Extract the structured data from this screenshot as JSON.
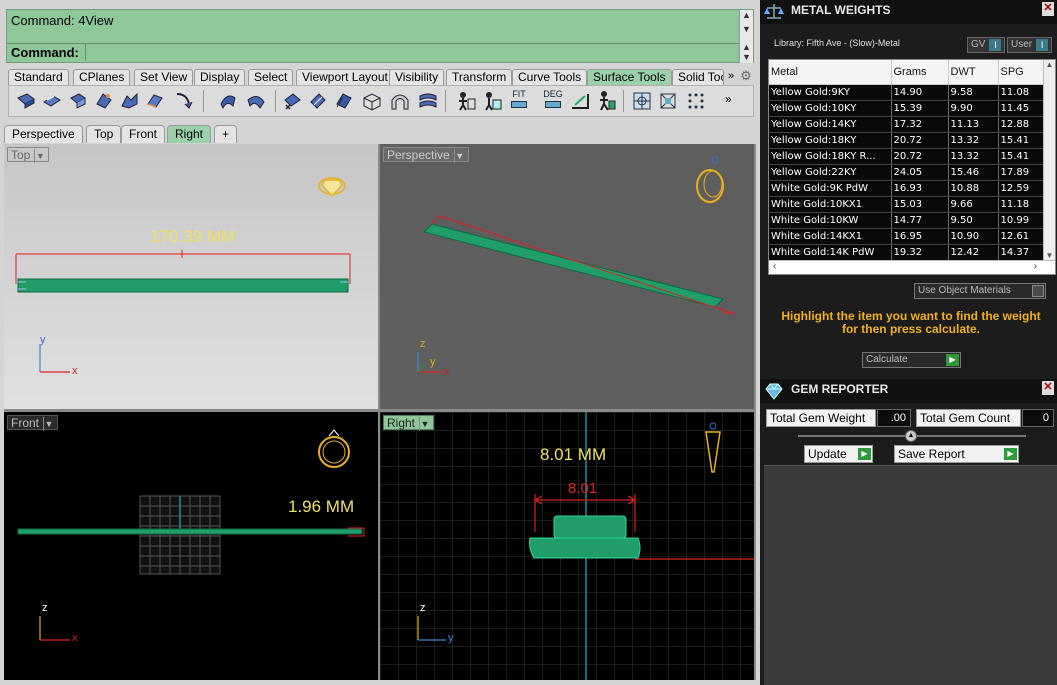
{
  "command": {
    "history_line": "Command: 4View",
    "prompt_label": "Command:",
    "prompt_value": ""
  },
  "toolbar_tabs": [
    {
      "label": "Standard"
    },
    {
      "label": "CPlanes"
    },
    {
      "label": "Set View"
    },
    {
      "label": "Display"
    },
    {
      "label": "Select"
    },
    {
      "label": "Viewport Layout"
    },
    {
      "label": "Visibility"
    },
    {
      "label": "Transform"
    },
    {
      "label": "Curve Tools"
    },
    {
      "label": "Surface Tools",
      "active": true
    },
    {
      "label": "Solid Toc"
    }
  ],
  "toolbar_more": "»",
  "icon_text": {
    "fit": "FIT",
    "deg": "DEG"
  },
  "viewport_tabs": [
    {
      "label": "Perspective"
    },
    {
      "label": "Top"
    },
    {
      "label": "Front"
    },
    {
      "label": "Right",
      "active": true
    },
    {
      "label": "+"
    }
  ],
  "viewports": {
    "top": {
      "label": "Top",
      "dimension": "170.39 MM",
      "axis_x": "x",
      "axis_y": "y"
    },
    "perspective": {
      "label": "Perspective",
      "axis_x": "x",
      "axis_y": "y",
      "axis_z": "z"
    },
    "front": {
      "label": "Front",
      "dimension": "1.96 MM",
      "axis_x": "x",
      "axis_z": "z"
    },
    "right": {
      "label": "Right",
      "dimension": "8.01 MM",
      "inner_dimension": "8.01",
      "axis_y": "y",
      "axis_z": "z"
    }
  },
  "metal_weights": {
    "title": "METAL WEIGHTS",
    "library": "Library: Fifth Ave - (Slow)-Metal",
    "toggle_gv": "GV",
    "toggle_user": "User",
    "columns": [
      "Metal",
      "Grams",
      "DWT",
      "SPG"
    ],
    "rows": [
      [
        "Yellow Gold:9KY",
        "14.90",
        "9.58",
        "11.08"
      ],
      [
        "Yellow Gold:10KY",
        "15.39",
        "9.90",
        "11.45"
      ],
      [
        "Yellow Gold:14KY",
        "17.32",
        "11.13",
        "12.88"
      ],
      [
        "Yellow Gold:18KY",
        "20.72",
        "13.32",
        "15.41"
      ],
      [
        "Yellow Gold:18KY R...",
        "20.72",
        "13.32",
        "15.41"
      ],
      [
        "Yellow Gold:22KY",
        "24.05",
        "15.46",
        "17.89"
      ],
      [
        "White Gold:9K PdW",
        "16.93",
        "10.88",
        "12.59"
      ],
      [
        "White Gold:10KX1",
        "15.03",
        "9.66",
        "11.18"
      ],
      [
        "White Gold:10KW",
        "14.77",
        "9.50",
        "10.99"
      ],
      [
        "White Gold:14KX1",
        "16.95",
        "10.90",
        "12.61"
      ],
      [
        "White Gold:14K PdW",
        "19.32",
        "12.42",
        "14.37"
      ]
    ],
    "use_object_materials": "Use Object Materials",
    "hint": "Highlight the item you want to find the weight for then press calculate.",
    "calculate_label": "Calculate"
  },
  "gem_reporter": {
    "title": "GEM REPORTER",
    "total_weight_label": "Total Gem Weight",
    "total_weight_value": ".00",
    "total_count_label": "Total Gem Count",
    "total_count_value": "0",
    "update_label": "Update",
    "save_report_label": "Save Report"
  },
  "colors": {
    "command_bg": "#8ec89a",
    "model_green": "#1f9e6a",
    "dimension_red": "#e02020",
    "dimension_text": "#f0e060",
    "hint_text": "#f0b020"
  }
}
